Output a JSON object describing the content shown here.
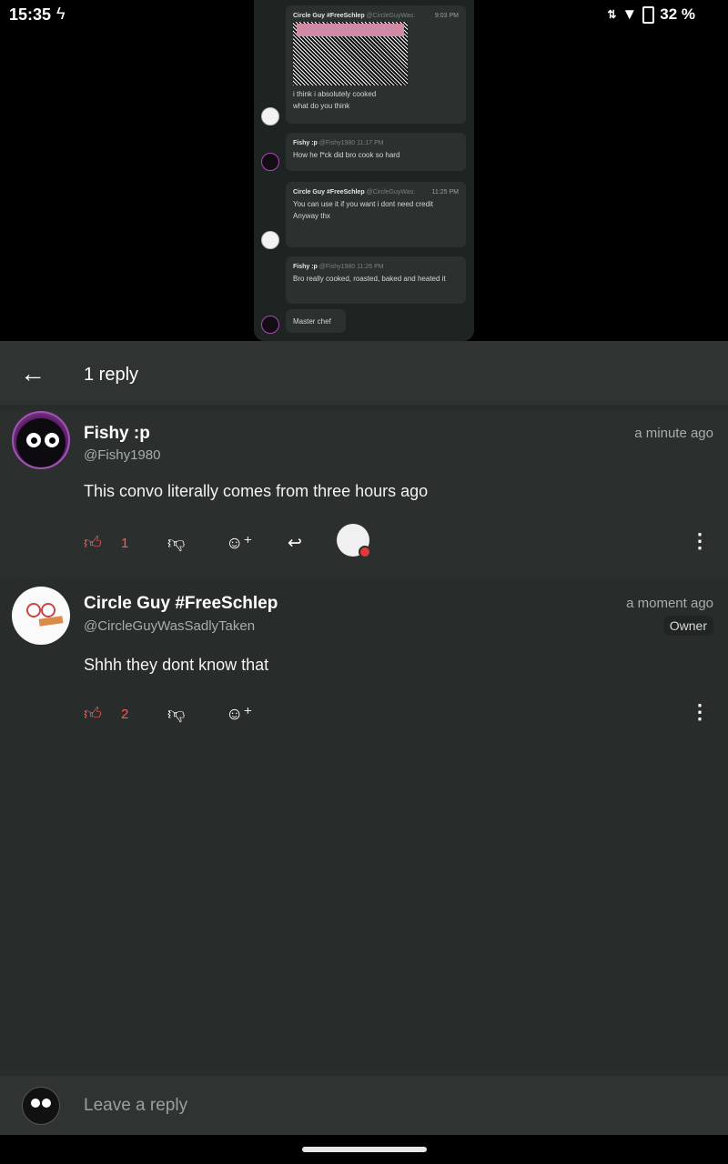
{
  "status": {
    "time": "15:35",
    "battery": "32 %"
  },
  "media": {
    "msgs": [
      {
        "author": "Circle Guy #FreeSchlep",
        "handle": "@CircleGuyWas:",
        "time": "9:03 PM",
        "text1": "i think i absolutely cooked",
        "text2": "what do you think"
      },
      {
        "author": "Fishy :p",
        "handle": "@Fishy1980",
        "time": "11:17 PM",
        "text1": "How he f*ck did bro cook so hard"
      },
      {
        "author": "Circle Guy #FreeSchlep",
        "handle": "@CircleGuyWas:",
        "time": "11:25 PM",
        "text1": "You can use it if you want i dont need credit",
        "text2": "Anyway thx"
      },
      {
        "author": "Fishy :p",
        "handle": "@Fishy1980",
        "time": "11:26 PM",
        "text1": "Bro really cooked, roasted, baked and heated it",
        "text2": "Master chef"
      }
    ]
  },
  "header": {
    "title": "1 reply"
  },
  "comments": [
    {
      "name": "Fishy :p",
      "handle": "@Fishy1980",
      "time": "a minute ago",
      "body": "This convo literally comes from three hours ago",
      "likes": "1"
    },
    {
      "name": "Circle Guy #FreeSchlep",
      "handle": "@CircleGuyWasSadlyTaken",
      "time": "a moment ago",
      "badge": "Owner",
      "body": "Shhh they dont know that",
      "likes": "2"
    }
  ],
  "compose": {
    "placeholder": "Leave a reply"
  },
  "icons": {
    "back": "arrow-left-icon",
    "like": "thumb-up-icon",
    "dislike": "thumb-down-icon",
    "react": "add-reaction-icon",
    "reply": "reply-icon",
    "more": "more-vert-icon"
  },
  "colors": {
    "accent_like": "#ff5a5a",
    "bg": "#282c2b"
  }
}
